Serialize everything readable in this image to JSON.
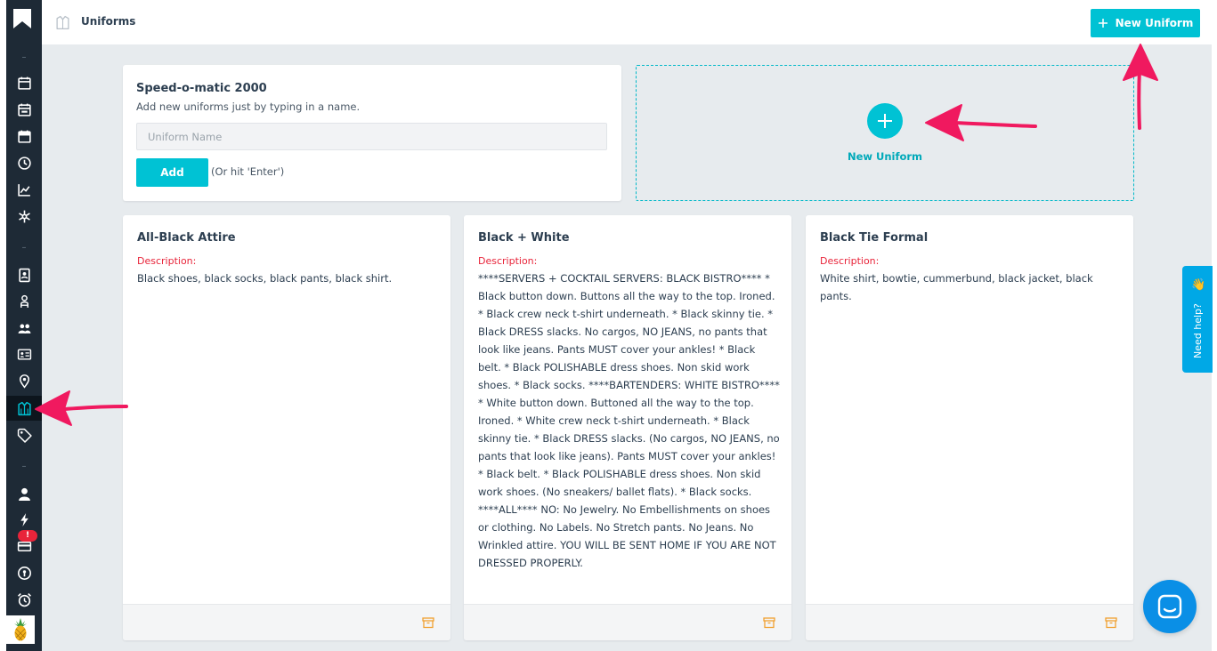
{
  "header": {
    "title": "Uniforms",
    "new_button_label": "New Uniform"
  },
  "speed": {
    "title": "Speed-o-matic 2000",
    "subtitle": "Add new uniforms just by typing in a name.",
    "input_placeholder": "Uniform Name",
    "add_label": "Add",
    "hint": "(Or hit 'Enter')"
  },
  "new_area": {
    "label": "New Uniform"
  },
  "uniforms": [
    {
      "title": "All-Black Attire",
      "desc_label": "Description:",
      "description": "Black shoes, black socks, black pants, black shirt."
    },
    {
      "title": "Black + White",
      "desc_label": "Description:",
      "description": "****SERVERS + COCKTAIL SERVERS: BLACK BISTRO**** * Black button down. Buttons all the way to the top. Ironed. * Black crew neck t-shirt underneath. * Black skinny tie. * Black DRESS slacks. No cargos, NO JEANS, no pants that look like jeans. Pants MUST cover your ankles! * Black belt. * Black POLISHABLE dress shoes. Non skid work shoes. * Black socks. ****BARTENDERS: WHITE BISTRO**** * White button down. Buttoned all the way to the top. Ironed. * White crew neck t-shirt underneath. * Black skinny tie. * Black DRESS slacks. (No cargos, NO JEANS, no pants that look like jeans). Pants MUST cover your ankles! * Black belt. * Black POLISHABLE dress shoes. Non skid work shoes. (No sneakers/ ballet flats). * Black socks. ****ALL**** NO: No Jewelry. No Embellishments on shoes or clothing. No Labels. No Stretch pants. No Jeans. No Wrinkled attire. YOU WILL BE SENT HOME IF YOU ARE NOT DRESSED PROPERLY."
    },
    {
      "title": "Black Tie Formal",
      "desc_label": "Description:",
      "description": "White shirt, bowtie, cummerbund, black jacket, black pants."
    }
  ],
  "sidebar": {
    "badge": "!",
    "separator": "–"
  },
  "help": {
    "label": "Need help?"
  },
  "colors": {
    "accent": "#00c2d4",
    "sidebar": "#1e2a36",
    "danger": "#e8243a",
    "annotation": "#f0195f"
  }
}
